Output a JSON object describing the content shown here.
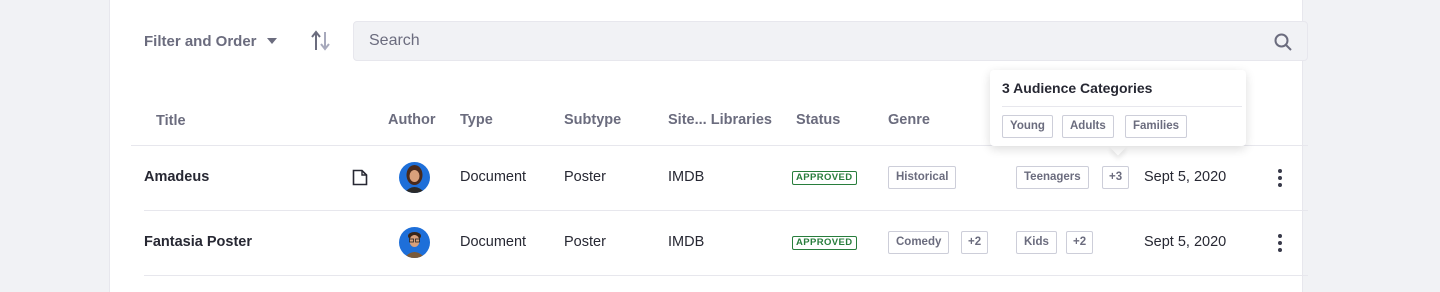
{
  "toolbar": {
    "filter_label": "Filter and Order",
    "search_placeholder": "Search"
  },
  "columns": [
    "Title",
    "Author",
    "Type",
    "Subtype",
    "Site... Libraries",
    "Status",
    "Genre"
  ],
  "rows": [
    {
      "title": "Amadeus",
      "type": "Document",
      "subtype": "Poster",
      "site": "IMDB",
      "status": "APPROVED",
      "genres": [
        "Historical"
      ],
      "audience": [
        "Teenagers",
        "+3"
      ],
      "date": "Sept 5, 2020"
    },
    {
      "title": "Fantasia Poster",
      "type": "Document",
      "subtype": "Poster",
      "site": "IMDB",
      "status": "APPROVED",
      "genres": [
        "Comedy",
        "+2"
      ],
      "audience": [
        "Kids",
        "+2"
      ],
      "date": "Sept 5, 2020"
    }
  ],
  "popover": {
    "title": "3 Audience Categories",
    "items": [
      "Young",
      "Adults",
      "Families"
    ]
  },
  "colors": {
    "status_green": "#287d3c",
    "avatar_blue": "#1e6fd9",
    "text_secondary": "#6b6c7e"
  }
}
